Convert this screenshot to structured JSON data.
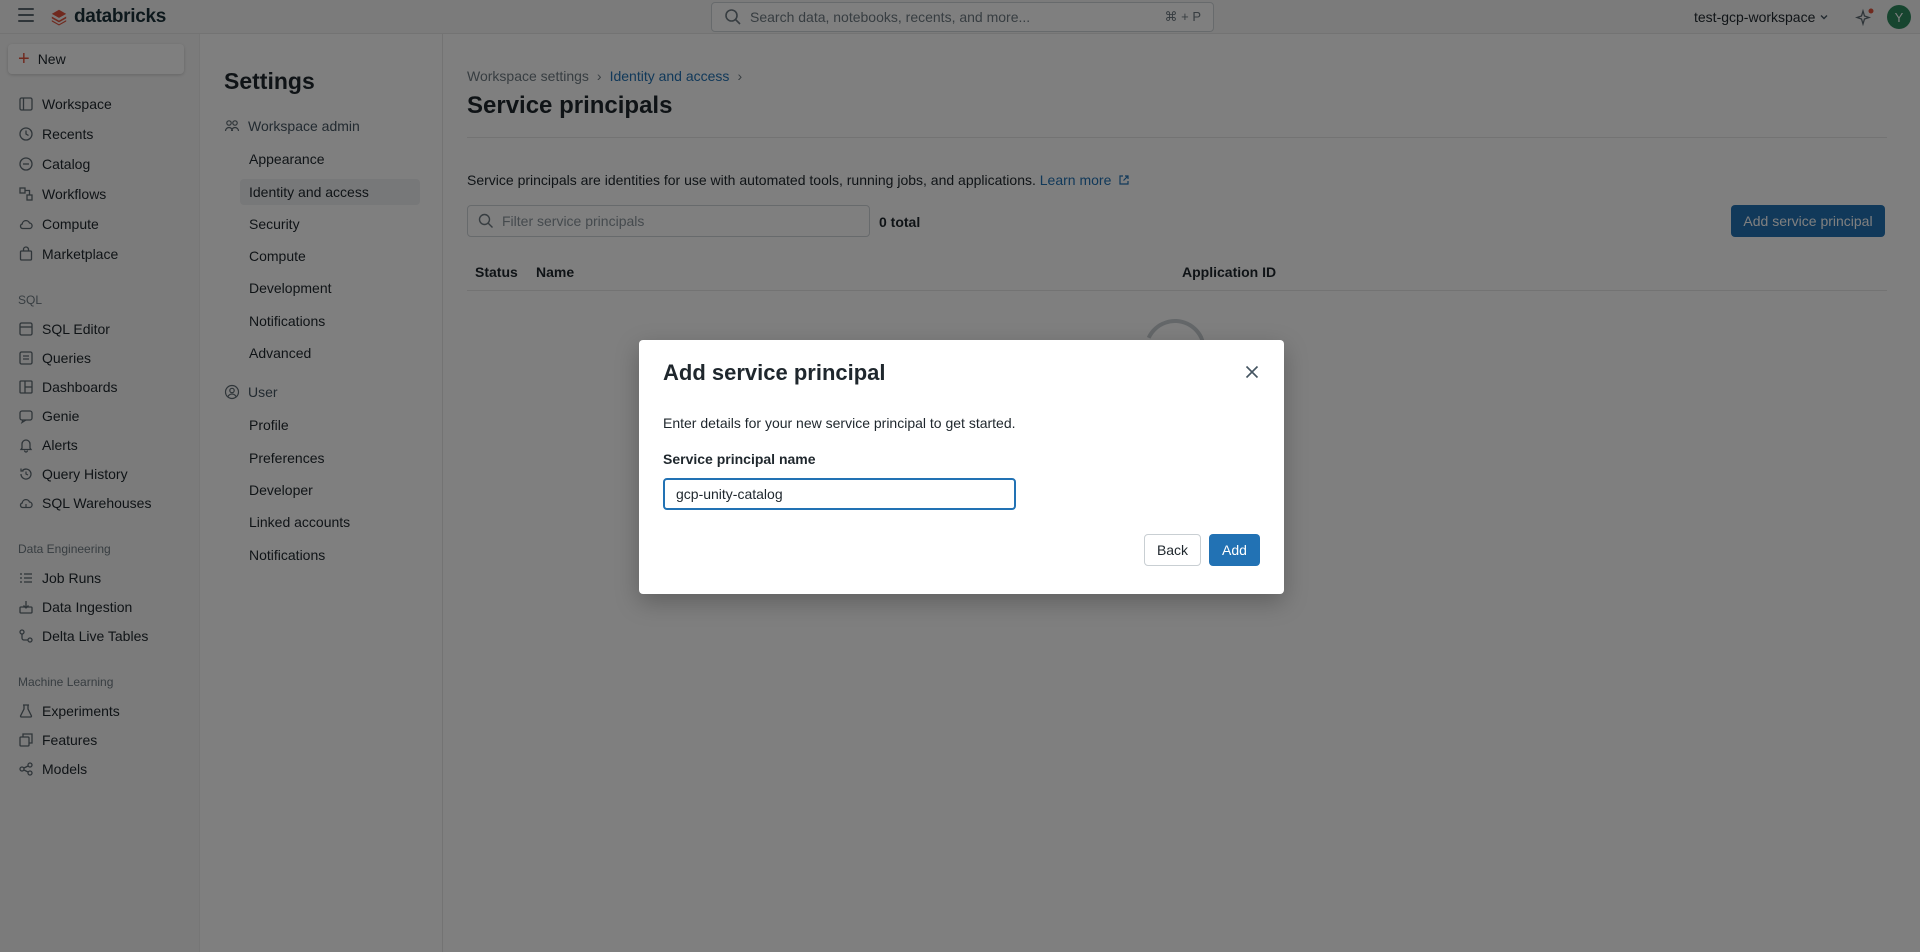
{
  "topbar": {
    "logo_text": "databricks",
    "search_placeholder": "Search data, notebooks, recents, and more...",
    "search_shortcut": "⌘ + P",
    "workspace_name": "test-gcp-workspace",
    "avatar_initial": "Y"
  },
  "leftnav": {
    "new_label": "New",
    "items": [
      {
        "label": "Workspace",
        "icon": "folder-icon"
      },
      {
        "label": "Recents",
        "icon": "clock-icon"
      },
      {
        "label": "Catalog",
        "icon": "catalog-icon"
      },
      {
        "label": "Workflows",
        "icon": "workflows-icon"
      },
      {
        "label": "Compute",
        "icon": "cloud-icon"
      },
      {
        "label": "Marketplace",
        "icon": "marketplace-icon"
      }
    ],
    "sql_section": "SQL",
    "sql_items": [
      {
        "label": "SQL Editor",
        "icon": "editor-icon"
      },
      {
        "label": "Queries",
        "icon": "queries-icon"
      },
      {
        "label": "Dashboards",
        "icon": "dashboard-icon"
      },
      {
        "label": "Genie",
        "icon": "genie-icon"
      },
      {
        "label": "Alerts",
        "icon": "bell-icon"
      },
      {
        "label": "Query History",
        "icon": "history-icon"
      },
      {
        "label": "SQL Warehouses",
        "icon": "warehouse-icon"
      }
    ],
    "de_section": "Data Engineering",
    "de_items": [
      {
        "label": "Job Runs",
        "icon": "list-icon"
      },
      {
        "label": "Data Ingestion",
        "icon": "ingestion-icon"
      },
      {
        "label": "Delta Live Tables",
        "icon": "pipeline-icon"
      }
    ],
    "ml_section": "Machine Learning",
    "ml_items": [
      {
        "label": "Experiments",
        "icon": "flask-icon"
      },
      {
        "label": "Features",
        "icon": "features-icon"
      },
      {
        "label": "Models",
        "icon": "models-icon"
      }
    ]
  },
  "settings": {
    "title": "Settings",
    "workspace_admin": "Workspace admin",
    "admin_items": [
      "Appearance",
      "Identity and access",
      "Security",
      "Compute",
      "Development",
      "Notifications",
      "Advanced"
    ],
    "user": "User",
    "user_items": [
      "Profile",
      "Preferences",
      "Developer",
      "Linked accounts",
      "Notifications"
    ]
  },
  "main": {
    "breadcrumb": [
      "Workspace settings",
      "Identity and access"
    ],
    "title": "Service principals",
    "description": "Service principals are identities for use with automated tools, running jobs, and applications.",
    "learn_more": "Learn more",
    "filter_placeholder": "Filter service principals",
    "total": "0 total",
    "add_button": "Add service principal",
    "columns": [
      "Status",
      "Name",
      "Application ID"
    ]
  },
  "modal": {
    "title": "Add service principal",
    "description": "Enter details for your new service principal to get started.",
    "field_label": "Service principal name",
    "field_value": "gcp-unity-catalog",
    "back_label": "Back",
    "add_label": "Add"
  }
}
